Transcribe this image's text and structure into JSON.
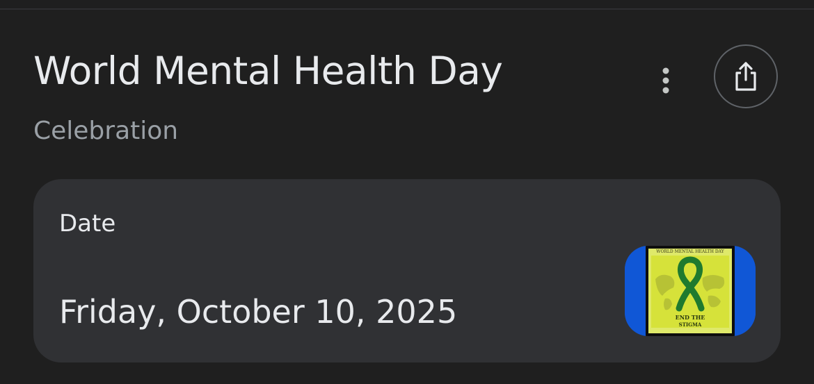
{
  "header": {
    "title": "World Mental Health Day",
    "subtitle": "Celebration"
  },
  "actions": {
    "more_icon": "more-vert-icon",
    "share_icon": "share-icon"
  },
  "date_card": {
    "label": "Date",
    "value": "Friday, October 10, 2025",
    "thumbnail_icon": "world-mental-health-day-poster",
    "thumbnail_text": [
      "WORLD MENTAL HEALTH DAY",
      "END THE",
      "STIGMA"
    ]
  },
  "colors": {
    "background": "#1f1f1f",
    "card": "#303134",
    "text_primary": "#e8eaed",
    "text_secondary": "#9aa0a6",
    "thumbnail_frame": "#1057d6",
    "ribbon": "#1f7a2e",
    "poster": "#d9e83a"
  }
}
